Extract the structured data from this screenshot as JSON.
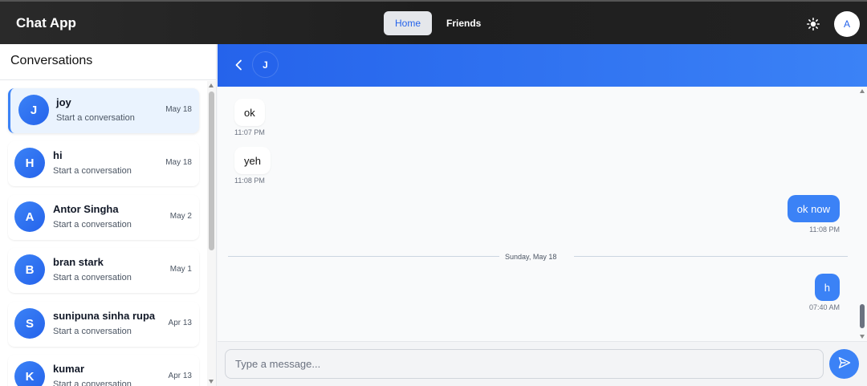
{
  "app": {
    "title": "Chat App"
  },
  "nav": {
    "items": [
      {
        "label": "Home",
        "active": true
      },
      {
        "label": "Friends",
        "active": false
      }
    ]
  },
  "user": {
    "avatar_initial": "A"
  },
  "sidebar": {
    "title": "Conversations",
    "conversations": [
      {
        "initial": "J",
        "name": "joy",
        "subtitle": "Start a conversation",
        "date": "May 18",
        "active": true
      },
      {
        "initial": "H",
        "name": "hi",
        "subtitle": "Start a conversation",
        "date": "May 18",
        "active": false
      },
      {
        "initial": "A",
        "name": "Antor Singha",
        "subtitle": "Start a conversation",
        "date": "May 2",
        "active": false
      },
      {
        "initial": "B",
        "name": "bran stark",
        "subtitle": "Start a conversation",
        "date": "May 1",
        "active": false
      },
      {
        "initial": "S",
        "name": "sunipuna sinha rupa",
        "subtitle": "Start a conversation",
        "date": "Apr 13",
        "active": false
      },
      {
        "initial": "K",
        "name": "kumar",
        "subtitle": "Start a conversation",
        "date": "Apr 13",
        "active": false
      }
    ]
  },
  "chat": {
    "contact_initial": "J",
    "messages": [
      {
        "text": "ok",
        "time": "11:07 PM",
        "direction": "in"
      },
      {
        "text": "yeh",
        "time": "11:08 PM",
        "direction": "in"
      },
      {
        "text": "ok now",
        "time": "11:08 PM",
        "direction": "out"
      },
      {
        "text": "h",
        "time": "07:40 AM",
        "direction": "out"
      }
    ],
    "date_divider": "Sunday, May 18"
  },
  "composer": {
    "placeholder": "Type a message..."
  },
  "colors": {
    "accent": "#3b82f6",
    "accent_dark": "#2563eb",
    "topbar": "#1e1e1e"
  },
  "icons": {
    "theme": "sun-icon",
    "back": "chevron-left-icon",
    "send": "send-icon"
  }
}
